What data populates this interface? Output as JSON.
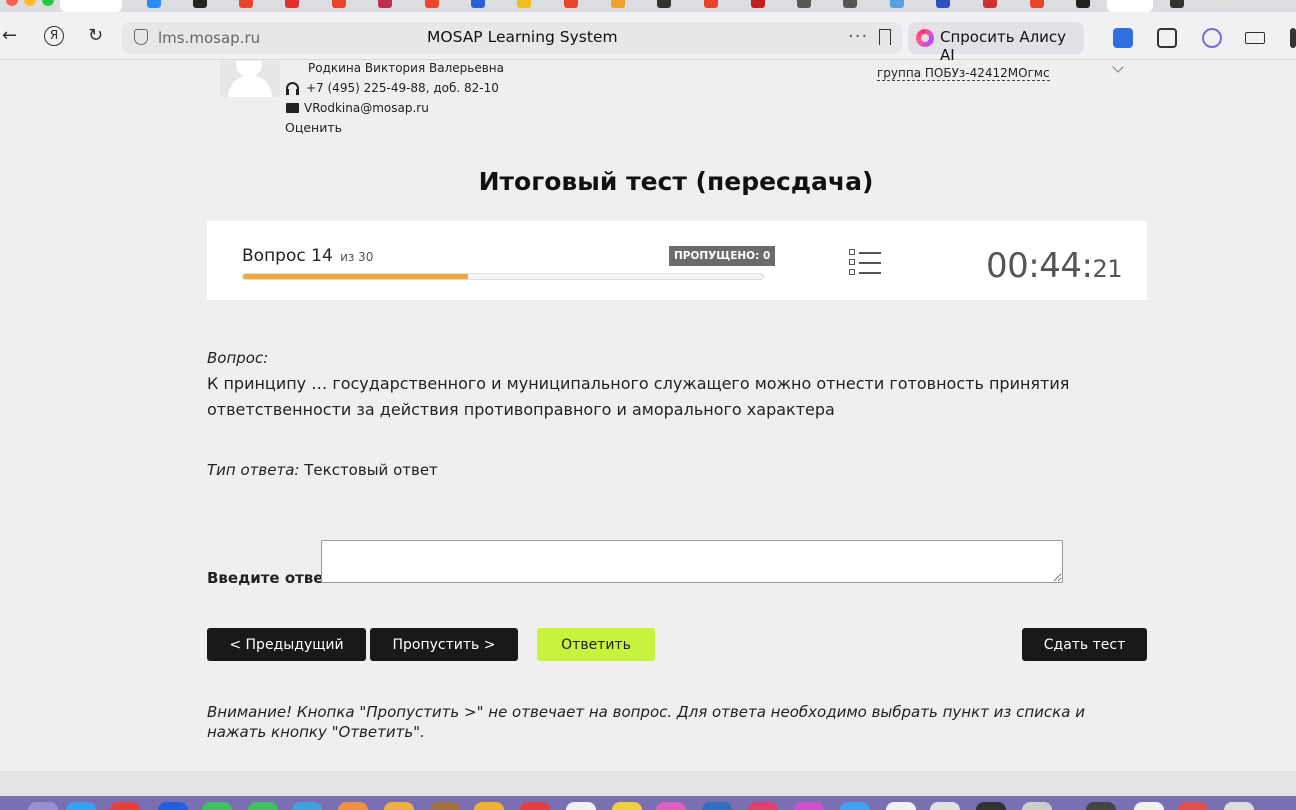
{
  "browser": {
    "url_host": "lms.mosap.ru",
    "page_title": "MOSAP Learning System",
    "alice_label": "Спросить Алису AI"
  },
  "teacher": {
    "name": "Родкина Виктория Валерьевна",
    "phone": "+7 (495) 225-49-88, доб. 82-10",
    "email": "VRodkina@mosap.ru",
    "rate_link": "Оценить"
  },
  "group": {
    "label": "группа ПОБУз-42412МОгмс"
  },
  "test": {
    "title": "Итоговый тест (пересдача)",
    "question_prefix": "Вопрос",
    "question_number": "14",
    "question_total_text": "из 30",
    "progress_fraction": 0.4333,
    "skipped_badge": "ПРОПУЩЕНО: 0",
    "timer_main": "00:44:",
    "timer_seconds": "21"
  },
  "question": {
    "caption": "Вопрос:",
    "text": "К принципу … государственного и муниципального служащего можно отнести готовность принятия ответственности за действия противоправного и аморального характера",
    "type_caption": "Тип ответа:",
    "type_value": "Текстовый ответ"
  },
  "answer": {
    "label": "Введите ответ:",
    "value": ""
  },
  "buttons": {
    "prev": "< Предыдущий",
    "skip": "Пропустить >",
    "answer": "Ответить",
    "submit": "Сдать тест"
  },
  "warning": "Внимание! Кнопка \"Пропустить >\" не отвечает на вопрос. Для ответа необходимо выбрать пункт из списка и нажать кнопку \"Ответить\"."
}
